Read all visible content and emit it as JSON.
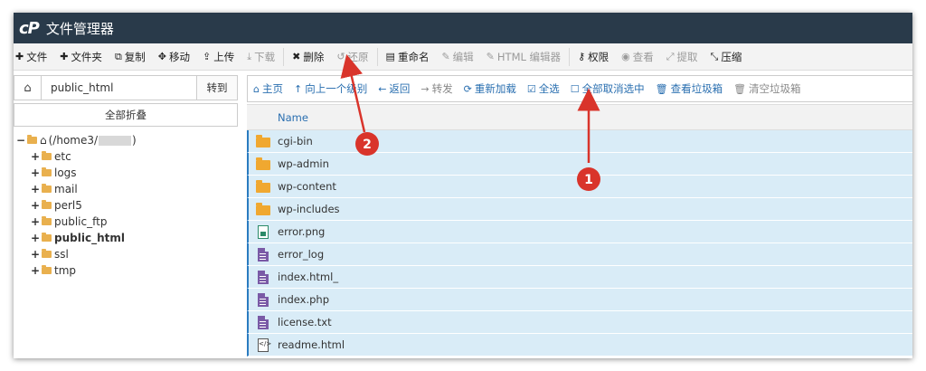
{
  "header": {
    "logo": "cP",
    "title": "文件管理器"
  },
  "toolbar": {
    "items": [
      {
        "icon": "plus-icon",
        "glyph": "✚",
        "label": "文件",
        "enabled": true
      },
      {
        "icon": "plus-icon",
        "glyph": "✚",
        "label": "文件夹",
        "enabled": true
      },
      {
        "icon": "copy-icon",
        "glyph": "⧉",
        "label": "复制",
        "enabled": true
      },
      {
        "icon": "move-icon",
        "glyph": "✥",
        "label": "移动",
        "enabled": true
      },
      {
        "icon": "upload-icon",
        "glyph": "⇪",
        "label": "上传",
        "enabled": true
      },
      {
        "icon": "download-icon",
        "glyph": "⤓",
        "label": "下载",
        "enabled": false
      },
      {
        "icon": "delete-icon",
        "glyph": "✖",
        "label": "删除",
        "enabled": true
      },
      {
        "icon": "restore-icon",
        "glyph": "↺",
        "label": "还原",
        "enabled": false
      },
      {
        "icon": "rename-icon",
        "glyph": "▤",
        "label": "重命名",
        "enabled": true
      },
      {
        "icon": "edit-icon",
        "glyph": "✎",
        "label": "编辑",
        "enabled": false
      },
      {
        "icon": "html-edit-icon",
        "glyph": "✎",
        "label": "HTML 编辑器",
        "enabled": false
      },
      {
        "icon": "key-icon",
        "glyph": "⚷",
        "label": "权限",
        "enabled": true
      },
      {
        "icon": "eye-icon",
        "glyph": "◉",
        "label": "查看",
        "enabled": false
      },
      {
        "icon": "extract-icon",
        "glyph": "⤢",
        "label": "提取",
        "enabled": false
      },
      {
        "icon": "compress-icon",
        "glyph": "⤡",
        "label": "压缩",
        "enabled": true
      }
    ]
  },
  "sidebar": {
    "path_value": "public_html",
    "go_label": "转到",
    "collapse_label": "全部折叠",
    "root_label": "(/home3/",
    "root_suffix": ")",
    "tree": [
      {
        "label": "etc",
        "bold": false
      },
      {
        "label": "logs",
        "bold": false
      },
      {
        "label": "mail",
        "bold": false
      },
      {
        "label": "perl5",
        "bold": false
      },
      {
        "label": "public_ftp",
        "bold": false
      },
      {
        "label": "public_html",
        "bold": true
      },
      {
        "label": "ssl",
        "bold": false
      },
      {
        "label": "tmp",
        "bold": false
      }
    ]
  },
  "nav": {
    "items": [
      {
        "icon": "home-icon",
        "glyph": "⌂",
        "label": "主页",
        "enabled": true
      },
      {
        "icon": "arrow-up-icon",
        "glyph": "↑",
        "label": "向上一个级别",
        "enabled": true
      },
      {
        "icon": "arrow-left-icon",
        "glyph": "←",
        "label": "返回",
        "enabled": true
      },
      {
        "icon": "arrow-right-icon",
        "glyph": "→",
        "label": "转发",
        "enabled": false
      },
      {
        "icon": "refresh-icon",
        "glyph": "⟳",
        "label": "重新加载",
        "enabled": true
      },
      {
        "icon": "checkbox-checked-icon",
        "glyph": "☑",
        "label": "全选",
        "enabled": true
      },
      {
        "icon": "checkbox-empty-icon",
        "glyph": "☐",
        "label": "全部取消选中",
        "enabled": true
      },
      {
        "icon": "trash-icon",
        "glyph": "🗑",
        "label": "查看垃圾箱",
        "enabled": true
      },
      {
        "icon": "trash-icon",
        "glyph": "🗑",
        "label": "清空垃圾箱",
        "enabled": false
      }
    ]
  },
  "table": {
    "header_name": "Name",
    "files": [
      {
        "name": "cgi-bin",
        "type": "folder"
      },
      {
        "name": "wp-admin",
        "type": "folder"
      },
      {
        "name": "wp-content",
        "type": "folder"
      },
      {
        "name": "wp-includes",
        "type": "folder"
      },
      {
        "name": "error.png",
        "type": "image"
      },
      {
        "name": "error_log",
        "type": "text"
      },
      {
        "name": "index.html_",
        "type": "text"
      },
      {
        "name": "index.php",
        "type": "text"
      },
      {
        "name": "license.txt",
        "type": "text"
      },
      {
        "name": "readme.html",
        "type": "code"
      }
    ]
  },
  "annotations": [
    {
      "number": "1",
      "color": "#d9342b"
    },
    {
      "number": "2",
      "color": "#d9342b"
    }
  ],
  "colors": {
    "header_bg": "#293a4a",
    "selected_row": "#d9ecf7",
    "link": "#2a6fb0",
    "annotation": "#d9342b"
  }
}
